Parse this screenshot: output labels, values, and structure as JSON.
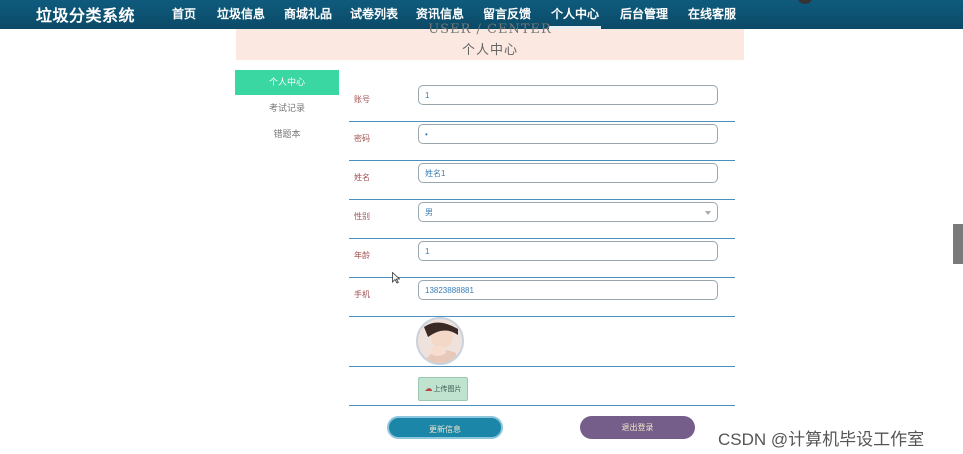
{
  "app": {
    "title": "垃圾分类系统"
  },
  "nav": {
    "items": [
      {
        "label": "首页"
      },
      {
        "label": "垃圾信息"
      },
      {
        "label": "商城礼品"
      },
      {
        "label": "试卷列表"
      },
      {
        "label": "资讯信息"
      },
      {
        "label": "留言反馈"
      },
      {
        "label": "个人中心",
        "active": true
      },
      {
        "label": "后台管理"
      },
      {
        "label": "在线客服"
      }
    ]
  },
  "header": {
    "title_en": "USER / CENTER",
    "title_cn": "个人中心"
  },
  "sidebar": {
    "items": [
      {
        "label": "个人中心",
        "active": true
      },
      {
        "label": "考试记录"
      },
      {
        "label": "错题本"
      }
    ]
  },
  "form": {
    "account": {
      "label": "账号",
      "value": "1"
    },
    "password": {
      "label": "密码",
      "value": "•"
    },
    "name": {
      "label": "姓名",
      "value": "姓名1"
    },
    "gender": {
      "label": "性别",
      "value": "男"
    },
    "age": {
      "label": "年龄",
      "value": "1"
    },
    "phone": {
      "label": "手机",
      "value": "13823888881"
    },
    "upload_label": "上传图片"
  },
  "actions": {
    "update_label": "更新信息",
    "logout_label": "退出登录"
  },
  "watermark": "CSDN @计算机毕设工作室",
  "colors": {
    "nav_bg": "#0f5b7d",
    "sidebar_active": "#3bd7a3",
    "update_btn": "#1c86a8",
    "logout_btn": "#765e8a",
    "header_band": "#fbe8e1"
  }
}
